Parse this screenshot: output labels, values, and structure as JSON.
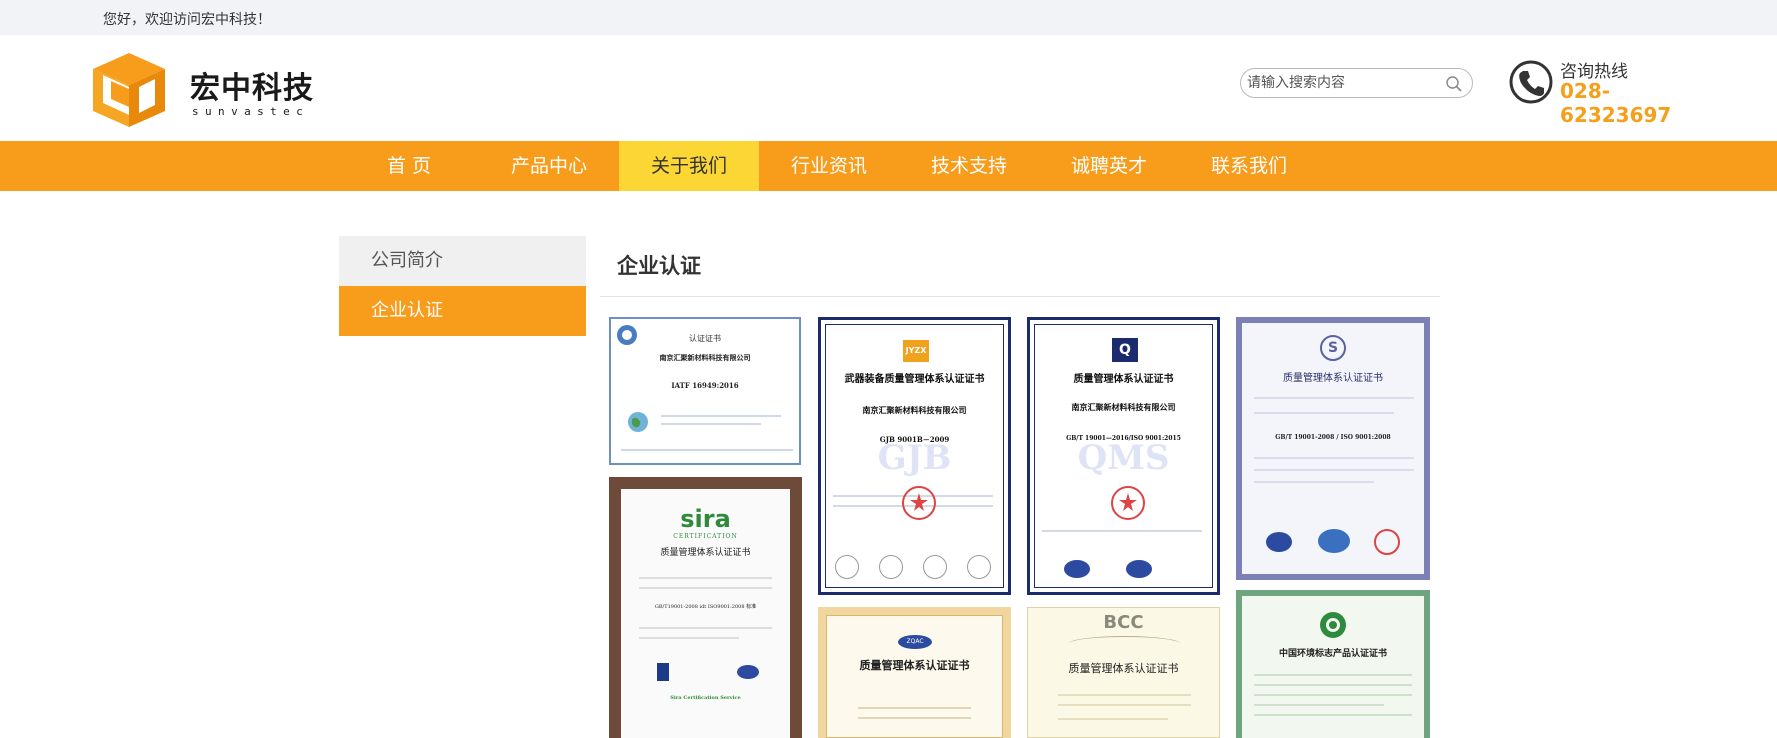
{
  "topbar": {
    "welcome": "您好，欢迎访问宏中科技！"
  },
  "logo": {
    "name": "宏中科技",
    "sub": "sunvastec"
  },
  "search": {
    "placeholder": "请输入搜索内容"
  },
  "hotline": {
    "label": "咨询热线",
    "number": "028-62323697"
  },
  "nav": [
    {
      "label": "首 页",
      "active": false
    },
    {
      "label": "产品中心",
      "active": false
    },
    {
      "label": "关于我们",
      "active": true
    },
    {
      "label": "行业资讯",
      "active": false
    },
    {
      "label": "技术支持",
      "active": false
    },
    {
      "label": "诚聘英才",
      "active": false
    },
    {
      "label": "联系我们",
      "active": false
    }
  ],
  "sidebar": [
    {
      "label": "公司简介",
      "active": false
    },
    {
      "label": "企业认证",
      "active": true
    }
  ],
  "content": {
    "title": "企业认证"
  },
  "certs": [
    {
      "heading": "认证证书",
      "company": "南京汇聚新材料科技有限公司",
      "standard": "IATF 16949:2016"
    },
    {
      "heading": "武器装备质量管理体系认证证书",
      "company": "南京汇聚新材料科技有限公司",
      "standard": "GJB 9001B－2009",
      "badge": "JYZX"
    },
    {
      "heading": "质量管理体系认证证书",
      "company": "南京汇聚新材料科技有限公司",
      "standard": "GB/T 19001—2016/ISO 9001:2015",
      "badge": "Q"
    },
    {
      "heading": "质量管理体系认证证书",
      "standard": "GB/T 19001-2008 / ISO 9001:2008",
      "badge": "S"
    },
    {
      "heading": "质量管理体系认证证书",
      "brand": "sira",
      "brand_sub": "CERTIFICATION",
      "standard": "GB/T19001-2008 idt ISO9001:2008 标准",
      "footer": "Sira Certification Service"
    },
    {
      "heading": "质量管理体系认证证书",
      "badge": "ZQAC"
    },
    {
      "heading": "质量管理体系认证证书",
      "brand": "BCC"
    },
    {
      "heading": "中国环境标志产品认证证书"
    }
  ]
}
